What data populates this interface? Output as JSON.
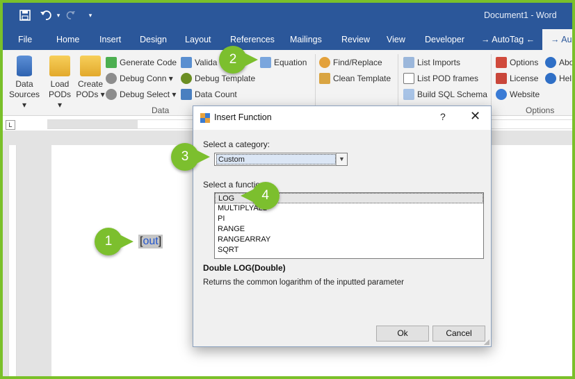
{
  "window": {
    "title": "Document1  -  Word"
  },
  "tabs": [
    {
      "label": "File"
    },
    {
      "label": "Home"
    },
    {
      "label": "Insert"
    },
    {
      "label": "Design"
    },
    {
      "label": "Layout"
    },
    {
      "label": "References"
    },
    {
      "label": "Mailings"
    },
    {
      "label": "Review"
    },
    {
      "label": "View"
    },
    {
      "label": "Developer"
    },
    {
      "label": "→ AutoTag ←"
    },
    {
      "label": "→ Au"
    }
  ],
  "ribbon": {
    "data_sources": "Data\nSources",
    "data_sources_a": "Data",
    "data_sources_b": "Sources",
    "load_pods_a": "Load",
    "load_pods_b": "PODs",
    "create_pods_a": "Create",
    "create_pods_b": "PODs",
    "generate_code": "Generate Code",
    "debug_conn": "Debug Conn",
    "debug_select": "Debug Select",
    "validate": "Valida",
    "debug_template": "Debug Template",
    "data_count": "Data Count",
    "equation": "Equation",
    "find_replace": "Find/Replace",
    "clean_template": "Clean Template",
    "list_imports": "List Imports",
    "list_pod_frames": "List POD frames",
    "build_sql_schema": "Build SQL Schema",
    "options": "Options",
    "license": "License",
    "website": "Website",
    "about": "Abo",
    "help": "Hel",
    "group_data": "Data",
    "group_options": "Options"
  },
  "document": {
    "field_open": "[",
    "field_text": "out",
    "field_close": "]"
  },
  "dialog": {
    "title": "Insert Function",
    "help": "?",
    "close": "✕",
    "category_label": "Select a category:",
    "category_value": "Custom",
    "function_label": "Select a function:",
    "functions": [
      "LOG",
      "MULTIPLYALL",
      "PI",
      "RANGE",
      "RANGEARRAY",
      "SQRT"
    ],
    "signature": "Double LOG(Double)",
    "description": "Returns the common logarithm of the inputted parameter",
    "ok_label": "Ok",
    "cancel_label": "Cancel"
  },
  "callouts": [
    "1",
    "2",
    "3",
    "4"
  ],
  "colors": {
    "accent": "#2b579a",
    "callout": "#7cbf2e",
    "border": "#7ac02a"
  }
}
